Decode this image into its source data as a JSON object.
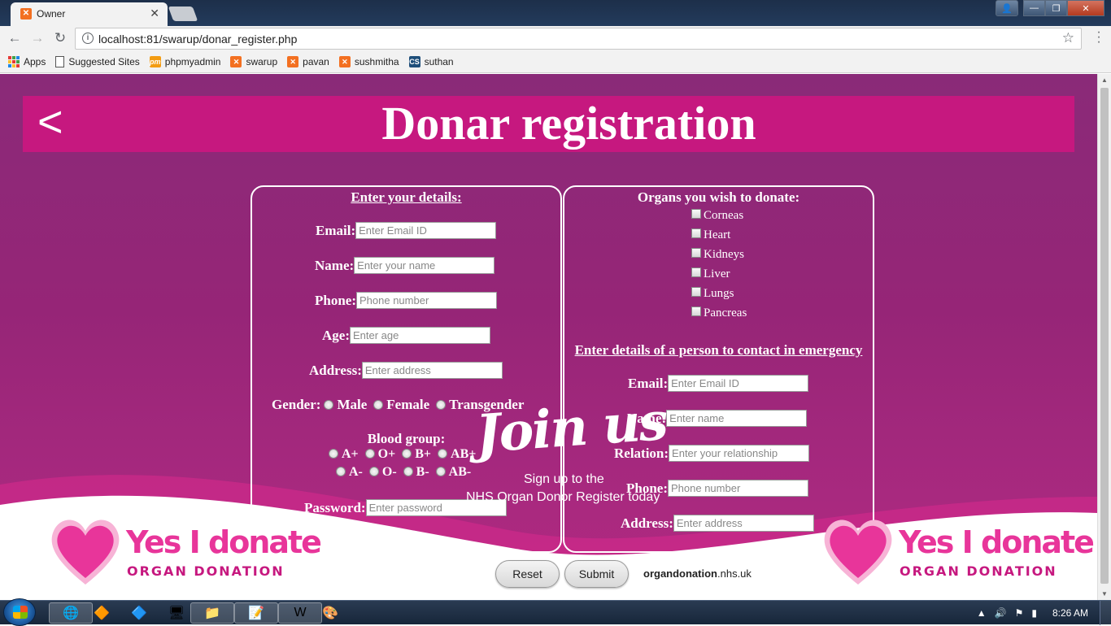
{
  "browser": {
    "tab_title": "Owner",
    "url": "localhost:81/swarup/donar_register.php",
    "bookmarks": [
      {
        "label": "Apps",
        "icon": "apps-grid-icon"
      },
      {
        "label": "Suggested Sites",
        "icon": "page-icon"
      },
      {
        "label": "phpmyadmin",
        "icon": "phpmyadmin-icon"
      },
      {
        "label": "swarup",
        "icon": "xampp-icon"
      },
      {
        "label": "pavan",
        "icon": "xampp-icon"
      },
      {
        "label": "sushmitha",
        "icon": "xampp-icon"
      },
      {
        "label": "suthan",
        "icon": "cs-icon"
      }
    ]
  },
  "page": {
    "back_label": "<",
    "title": "Donar registration",
    "left": {
      "heading": "Enter your details:",
      "email_label": "Email:",
      "email_placeholder": "Enter Email ID",
      "name_label": "Name:",
      "name_placeholder": "Enter your name",
      "phone_label": "Phone:",
      "phone_placeholder": "Phone number",
      "age_label": "Age:",
      "age_placeholder": "Enter age",
      "address_label": "Address:",
      "address_placeholder": "Enter address",
      "gender_label": "Gender:",
      "gender_options": [
        "Male",
        "Female",
        "Transgender"
      ],
      "blood_label": "Blood group:",
      "blood_row1": [
        "A+",
        "O+",
        "B+",
        "AB+"
      ],
      "blood_row2": [
        "A-",
        "O-",
        "B-",
        "AB-"
      ],
      "password_label": "Password:",
      "password_placeholder": "Enter password"
    },
    "right": {
      "organs_heading": "Organs you wish to donate:",
      "organs": [
        "Corneas",
        "Heart",
        "Kidneys",
        "Liver",
        "Lungs",
        "Pancreas"
      ],
      "emergency_heading": "Enter details of a person to contact in emergency",
      "email_label": "Email:",
      "email_placeholder": "Enter Email ID",
      "name_label": "Name:",
      "name_placeholder": "Enter name",
      "relation_label": "Relation:",
      "relation_placeholder": "Enter your relationship",
      "phone_label": "Phone:",
      "phone_placeholder": "Phone number",
      "address_label": "Address:",
      "address_placeholder": "Enter address"
    },
    "reset_label": "Reset",
    "submit_label": "Submit",
    "site_bold": "organdonation",
    "site_rest": ".nhs.uk",
    "join_us": "Join us",
    "join_sub1": "Sign up to the",
    "join_sub2": "NHS Organ Donor Register today",
    "logo_text": "Yes I donate",
    "logo_sub": "ORGAN DONATION"
  },
  "taskbar": {
    "clock": "8:26 AM"
  },
  "colors": {
    "background": "#962577",
    "banner": "#c6187f",
    "logo_pink": "#e8359a"
  }
}
